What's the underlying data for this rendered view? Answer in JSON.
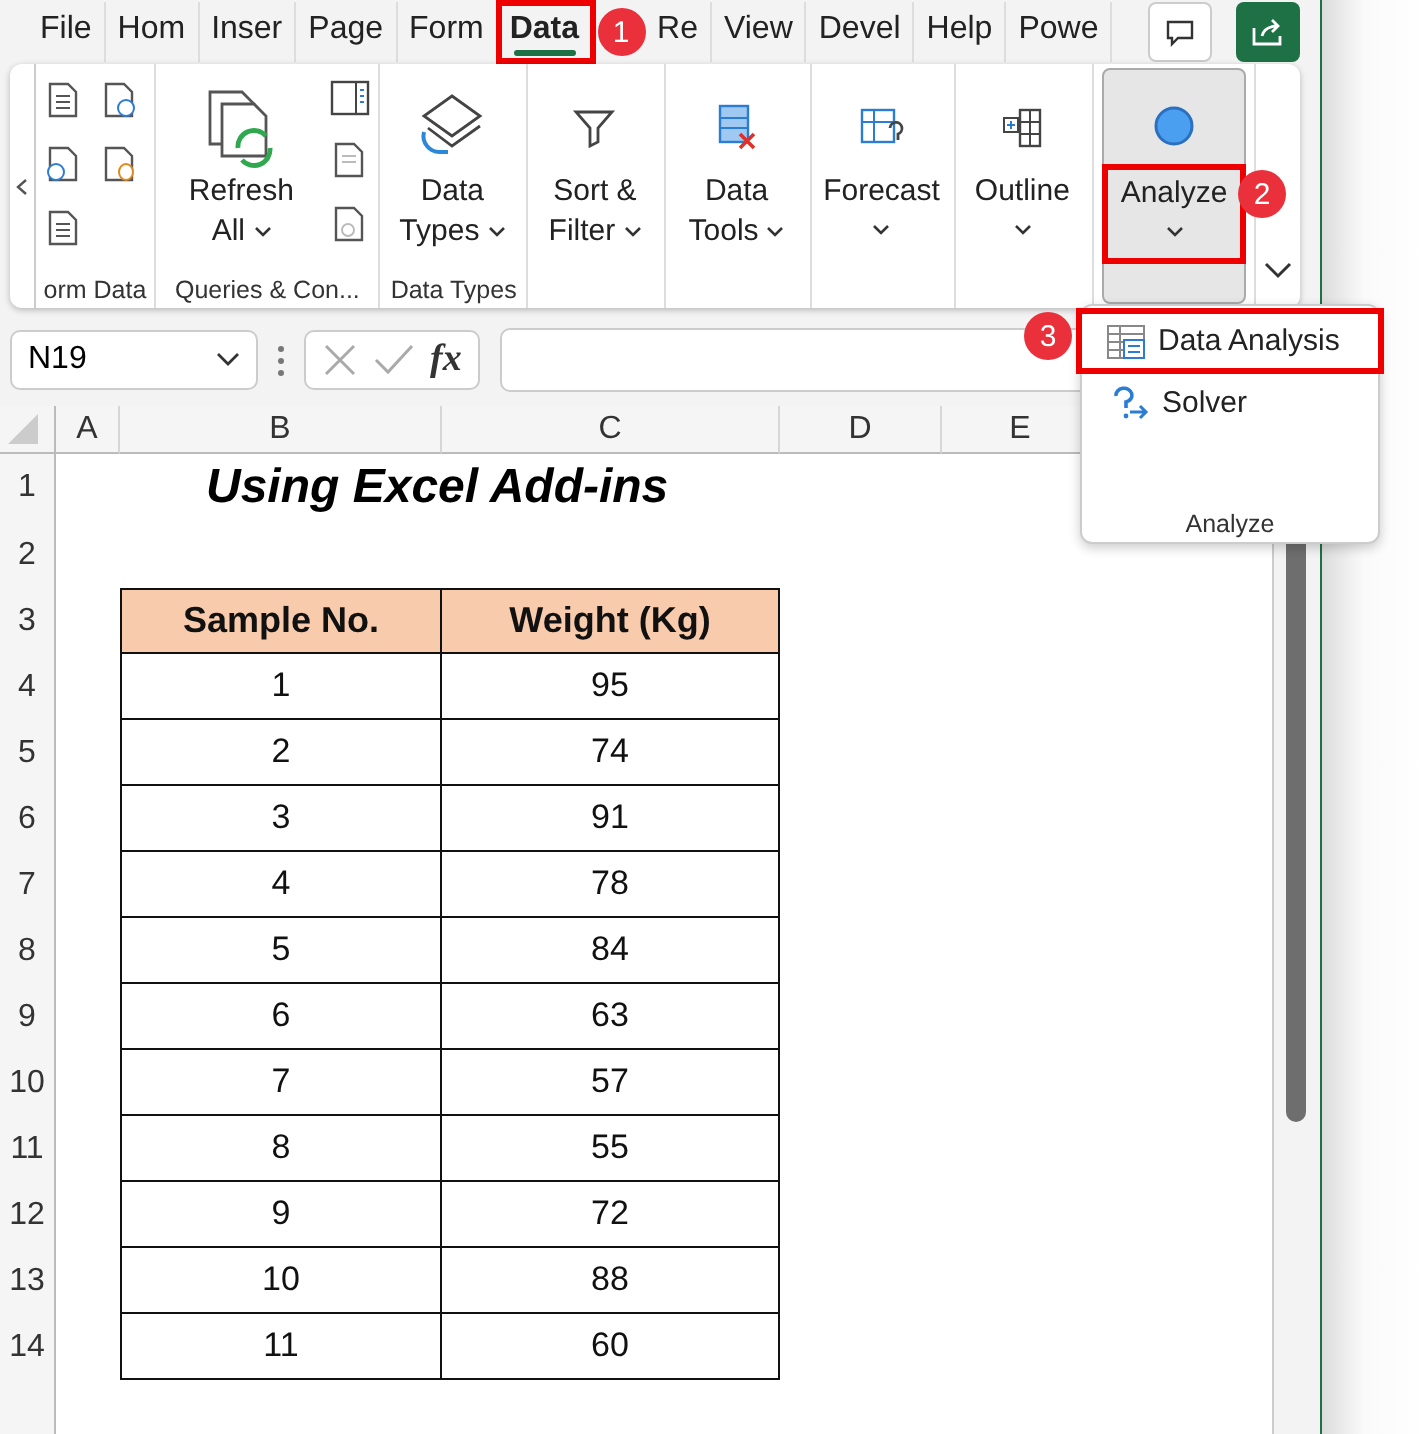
{
  "ribbon_tabs": [
    {
      "label": "File",
      "selected": false
    },
    {
      "label": "Hom",
      "selected": false
    },
    {
      "label": "Inser",
      "selected": false
    },
    {
      "label": "Page",
      "selected": false
    },
    {
      "label": "Form",
      "selected": false
    },
    {
      "label": "Data",
      "selected": true,
      "highlighted": true,
      "callout": "1"
    },
    {
      "label": "Re",
      "selected": false
    },
    {
      "label": "View",
      "selected": false
    },
    {
      "label": "Devel",
      "selected": false
    },
    {
      "label": "Help",
      "selected": false
    },
    {
      "label": "Powe",
      "selected": false
    }
  ],
  "ribbon": {
    "groups": [
      {
        "label": "orm Data",
        "kind": "get-data"
      },
      {
        "label": "Queries & Con...",
        "kind": "queries",
        "buttons": [
          {
            "lines": [
              "Refresh",
              "All"
            ],
            "dropdown": true,
            "kind": "refresh"
          }
        ]
      },
      {
        "label": "Data Types",
        "kind": "types",
        "buttons": [
          {
            "lines": [
              "Data",
              "Types"
            ],
            "dropdown": true,
            "kind": "types"
          }
        ]
      },
      {
        "kind": "plain",
        "buttons": [
          {
            "lines": [
              "Sort &",
              "Filter"
            ],
            "dropdown": true,
            "kind": "filter"
          }
        ]
      },
      {
        "kind": "plain",
        "buttons": [
          {
            "lines": [
              "Data",
              "Tools"
            ],
            "dropdown": true,
            "kind": "tools"
          }
        ]
      },
      {
        "kind": "plain",
        "buttons": [
          {
            "lines": [
              "Forecast"
            ],
            "dropdown": true,
            "kind": "forecast"
          }
        ]
      },
      {
        "kind": "plain",
        "buttons": [
          {
            "lines": [
              "Outline"
            ],
            "dropdown": true,
            "kind": "outline"
          }
        ]
      },
      {
        "kind": "plain",
        "buttons": [
          {
            "lines": [
              "Analyze"
            ],
            "dropdown": true,
            "kind": "analyze",
            "pressed": true,
            "highlighted": true,
            "callout": "2"
          }
        ]
      }
    ]
  },
  "formula_bar": {
    "name_box": "N19",
    "function_label": "fx"
  },
  "sheet": {
    "columns": [
      "A",
      "B",
      "C",
      "D",
      "E"
    ],
    "row_numbers": [
      "1",
      "2",
      "3",
      "4",
      "5",
      "6",
      "7",
      "8",
      "9",
      "10",
      "11",
      "12",
      "13",
      "14"
    ],
    "title": "Using Excel Add-ins",
    "table": {
      "headers": [
        "Sample No.",
        "Weight (Kg)"
      ],
      "rows": [
        [
          "1",
          "95"
        ],
        [
          "2",
          "74"
        ],
        [
          "3",
          "91"
        ],
        [
          "4",
          "78"
        ],
        [
          "5",
          "84"
        ],
        [
          "6",
          "63"
        ],
        [
          "7",
          "57"
        ],
        [
          "8",
          "55"
        ],
        [
          "9",
          "72"
        ],
        [
          "10",
          "88"
        ],
        [
          "11",
          "60"
        ]
      ]
    }
  },
  "analyze_menu": {
    "items": [
      {
        "label": "Data Analysis",
        "kind": "analysis",
        "highlighted": true,
        "callout": "3"
      },
      {
        "label": "Solver",
        "kind": "solver",
        "highlighted": false
      }
    ],
    "footer": "Analyze"
  }
}
